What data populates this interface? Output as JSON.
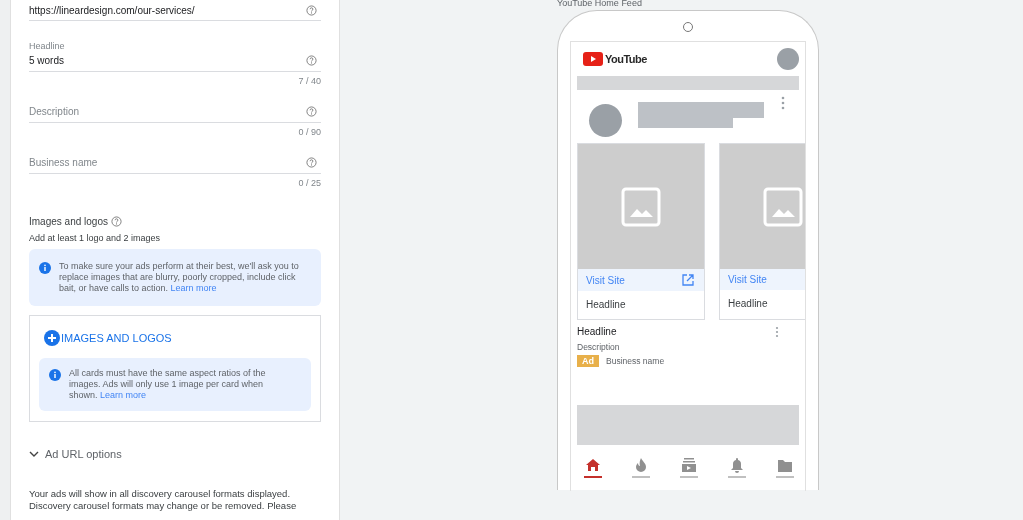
{
  "form": {
    "fields": [
      {
        "value": "https://lineardesign.com/our-services/"
      },
      {
        "label": "Headline",
        "value": "5 words",
        "counter": "7 / 40"
      },
      {
        "label": "Description",
        "counter": "0 / 90"
      },
      {
        "label": "Business name",
        "counter": "0 / 25"
      }
    ],
    "images": {
      "title": "Images and logos",
      "hint": "Add at least 1 logo and 2 images",
      "notice": {
        "text": "To make sure your ads perform at their best, we'll ask you to replace images that are blurry, poorly cropped, include click bait, or have calls to action.",
        "link": "Learn more"
      },
      "add_button": "IMAGES AND LOGOS",
      "card_notice": {
        "text": "All cards must have the same aspect ratios of the images. Ads will only use 1 image per card when shown.",
        "link": "Learn more"
      }
    },
    "url_options": {
      "label": "Ad URL options",
      "expanded": false
    },
    "footer": "Your ads will show in all discovery carousel formats displayed. Discovery carousel formats may change or be removed. Please"
  },
  "preview": {
    "title": "YouTube Home Feed",
    "logo": "YouTube",
    "cards": [
      {
        "link": "Visit Site",
        "external_link": true,
        "headline": "Headline"
      },
      {
        "link": "Visit Site",
        "external_link": false,
        "headline": "Headline"
      }
    ],
    "headline": "Headline",
    "description": "Description",
    "badge": "Ad",
    "business": "Business name",
    "nav": [
      {
        "kind": "home",
        "selected": true
      },
      {
        "kind": "trending",
        "selected": false
      },
      {
        "kind": "subscriptions",
        "selected": false
      },
      {
        "kind": "notifications",
        "selected": false
      },
      {
        "kind": "library",
        "selected": false
      }
    ]
  }
}
